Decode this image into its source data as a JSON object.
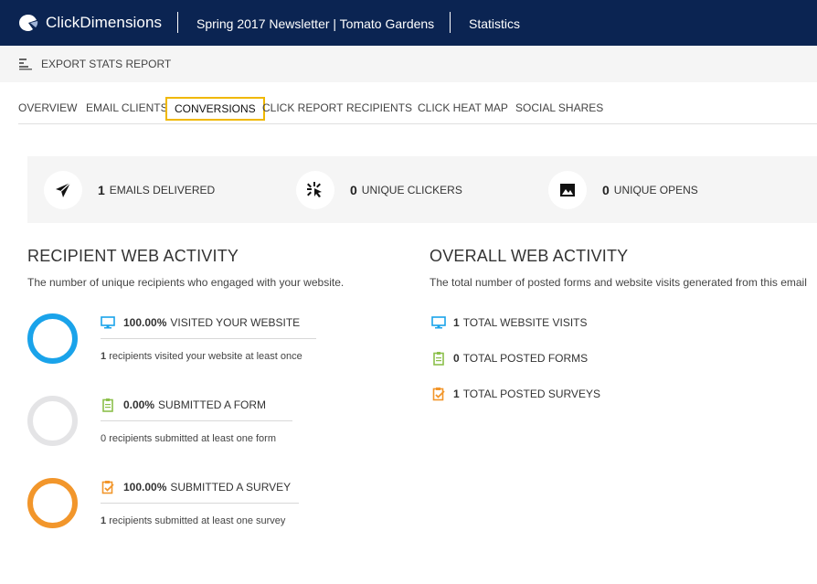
{
  "header": {
    "app_name": "ClickDimensions",
    "email_title": "Spring 2017 Newsletter | Tomato Gardens",
    "section": "Statistics"
  },
  "toolbar": {
    "export_label": "EXPORT STATS REPORT"
  },
  "tabs": [
    {
      "label": "OVERVIEW",
      "active": false
    },
    {
      "label": "EMAIL CLIENTS",
      "active": false
    },
    {
      "label": "CONVERSIONS",
      "active": true
    },
    {
      "label": "CLICK REPORT",
      "active": false
    },
    {
      "label": "RECIPIENTS",
      "active": false
    },
    {
      "label": "CLICK HEAT MAP",
      "active": false
    },
    {
      "label": "SOCIAL SHARES",
      "active": false
    }
  ],
  "stats": [
    {
      "value": "1",
      "label": "EMAILS DELIVERED",
      "icon": "paper-plane-icon"
    },
    {
      "value": "0",
      "label": "UNIQUE CLICKERS",
      "icon": "click-burst-icon"
    },
    {
      "value": "0",
      "label": "UNIQUE OPENS",
      "icon": "open-envelope-icon"
    }
  ],
  "recipient_activity": {
    "title": "RECIPIENT WEB ACTIVITY",
    "subtitle": "The number of unique recipients who engaged with your website.",
    "items": [
      {
        "percent": "100.00%",
        "label": "VISITED YOUR WEBSITE",
        "count": "1",
        "desc": "recipients visited your website at least once",
        "ring_color": "#1aa3ea",
        "icon": "monitor-icon"
      },
      {
        "percent": "0.00%",
        "label": "SUBMITTED A FORM",
        "count": "0",
        "desc": "recipients submitted at least one form",
        "ring_color": "#e4e4e6",
        "icon": "clipboard-icon"
      },
      {
        "percent": "100.00%",
        "label": "SUBMITTED A SURVEY",
        "count": "1",
        "desc": "recipients submitted at least one survey",
        "ring_color": "#f2962b",
        "icon": "survey-check-icon"
      }
    ]
  },
  "overall_activity": {
    "title": "OVERALL WEB ACTIVITY",
    "subtitle": "The total number of posted forms and website visits generated from this email",
    "items": [
      {
        "value": "1",
        "label": "TOTAL WEBSITE VISITS",
        "icon": "monitor-icon"
      },
      {
        "value": "0",
        "label": "TOTAL POSTED FORMS",
        "icon": "clipboard-icon"
      },
      {
        "value": "1",
        "label": "TOTAL POSTED SURVEYS",
        "icon": "survey-check-icon"
      }
    ]
  },
  "colors": {
    "header_bg": "#0b2452",
    "active_tab_border": "#f0b800",
    "visit_blue": "#1aa3ea",
    "form_green": "#8cc04b",
    "survey_orange": "#f2962b"
  }
}
